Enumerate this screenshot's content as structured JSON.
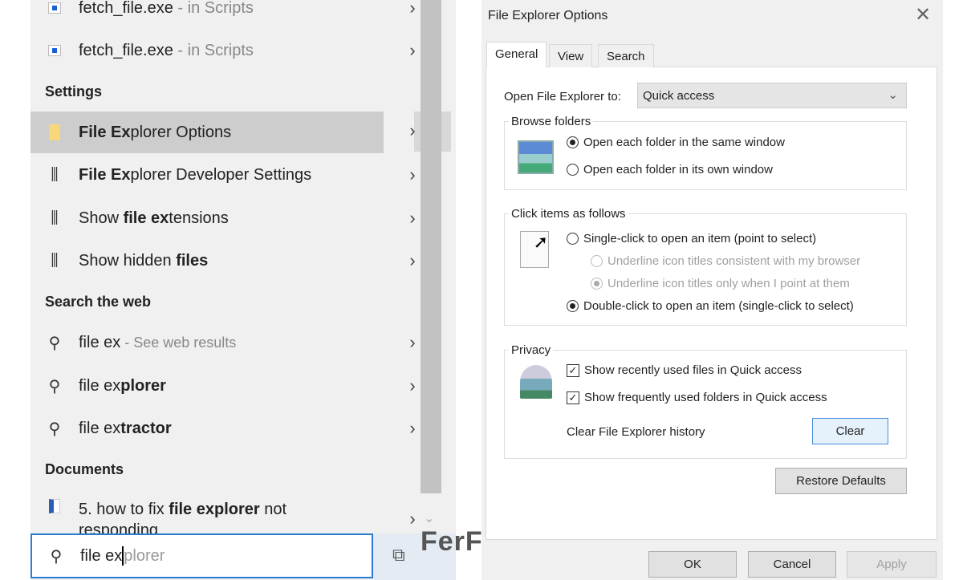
{
  "search_panel": {
    "results": [
      {
        "icon": "exe-icon",
        "name": "fetch_file.exe",
        "suffix": " - in Scripts"
      },
      {
        "icon": "exe-icon",
        "name": "fetch_file.exe",
        "suffix": " - in Scripts"
      }
    ],
    "settings_header": "Settings",
    "settings": [
      {
        "icon": "folder-options-icon",
        "pre": "",
        "bold": "File Ex",
        "post": "plorer Options"
      },
      {
        "icon": "settings-tools-icon",
        "pre": "",
        "bold": "File Ex",
        "post": "plorer Developer Settings"
      },
      {
        "icon": "settings-tools-icon",
        "pre": "Show ",
        "bold": "file ex",
        "post": "tensions"
      },
      {
        "icon": "settings-tools-icon",
        "pre": "Show hidden ",
        "bold": "files",
        "post": ""
      }
    ],
    "web_header": "Search the web",
    "web": [
      {
        "pre": "file ex",
        "bold": "",
        "post": "",
        "suffix": " - See web results"
      },
      {
        "pre": "file ex",
        "bold": "plorer",
        "post": "",
        "suffix": ""
      },
      {
        "pre": "file ex",
        "bold": "tractor",
        "post": "",
        "suffix": ""
      }
    ],
    "documents_header": "Documents",
    "documents": [
      {
        "pre": "5. how to fix ",
        "bold": "file explorer",
        "post": " not responding"
      }
    ],
    "search_box": {
      "typed": "file ex",
      "suggestion": "plorer"
    }
  },
  "watermark": "FerFere",
  "dialog": {
    "title": "File Explorer Options",
    "tabs": [
      "General",
      "View",
      "Search"
    ],
    "active_tab": "General",
    "open_to_label": "Open File Explorer to:",
    "open_to_value": "Quick access",
    "browse": {
      "label": "Browse folders",
      "options": [
        "Open each folder in the same window",
        "Open each folder in its own window"
      ],
      "selected": 0
    },
    "click": {
      "label": "Click items as follows",
      "single": "Single-click to open an item (point to select)",
      "sub": [
        "Underline icon titles consistent with my browser",
        "Underline icon titles only when I point at them"
      ],
      "double": "Double-click to open an item (single-click to select)"
    },
    "privacy": {
      "label": "Privacy",
      "recent_files": "Show recently used files in Quick access",
      "frequent_folders": "Show frequently used folders in Quick access",
      "clear_label": "Clear File Explorer history",
      "clear_button": "Clear"
    },
    "restore_defaults": "Restore Defaults",
    "ok": "OK",
    "cancel": "Cancel",
    "apply": "Apply"
  }
}
